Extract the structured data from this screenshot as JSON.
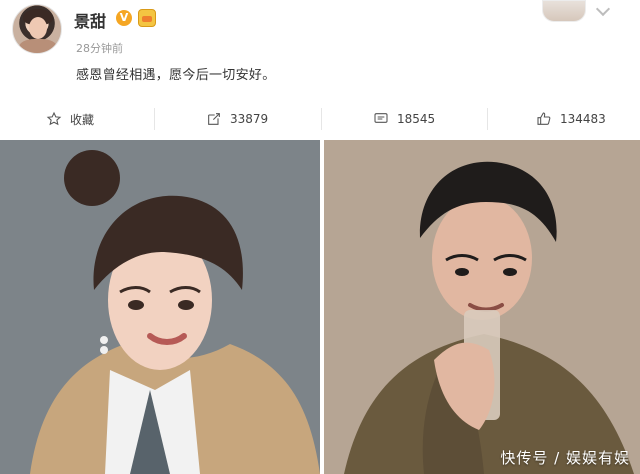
{
  "post": {
    "username": "景甜",
    "verified_badge": "V",
    "time": "28分钟前",
    "content": "感恩曾经相遇，愿今后一切安好。"
  },
  "actions": [
    {
      "icon": "star-icon",
      "label": "收藏"
    },
    {
      "icon": "share-icon",
      "label": "33879"
    },
    {
      "icon": "comment-icon",
      "label": "18545"
    },
    {
      "icon": "like-icon",
      "label": "134483"
    }
  ],
  "watermark": "快传号 / 娱娱有娱",
  "colors": {
    "badge": "#f5a623",
    "text": "#333333",
    "muted": "#999999"
  }
}
